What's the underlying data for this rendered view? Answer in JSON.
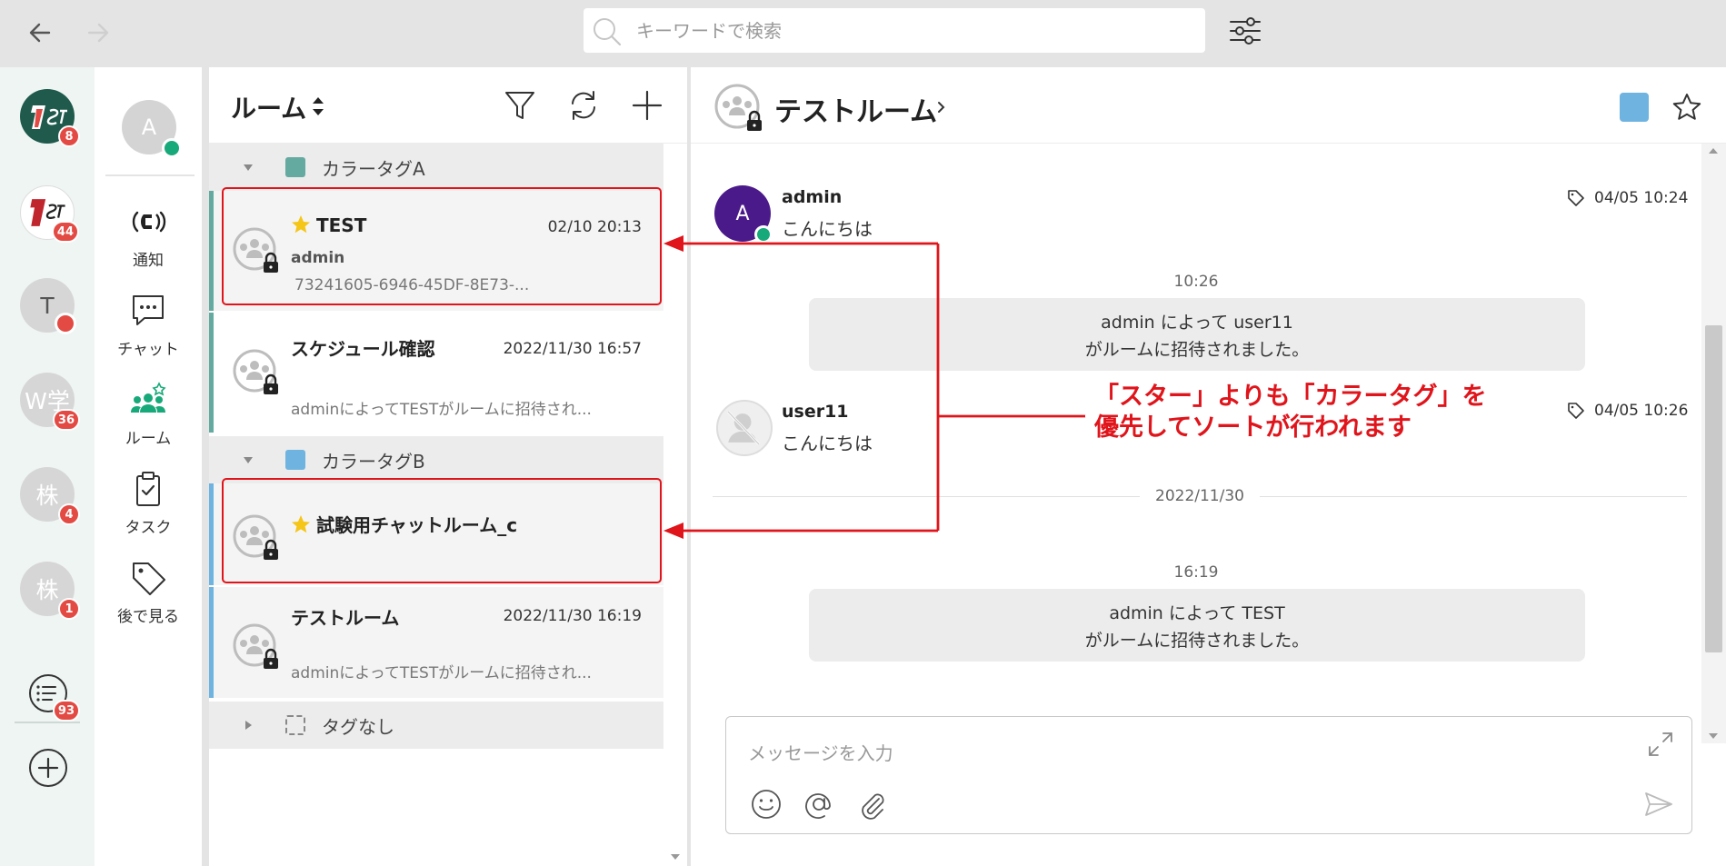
{
  "search": {
    "placeholder": "キーワードで検索"
  },
  "orgs": [
    {
      "label": "1ST",
      "badge": "8"
    },
    {
      "label": "1ST",
      "badge": "44"
    },
    {
      "label": "T",
      "badge": ""
    },
    {
      "label": "W学",
      "badge": "36"
    },
    {
      "label": "株",
      "badge": "4"
    },
    {
      "label": "株",
      "badge": "1"
    }
  ],
  "rail_list_badge": "93",
  "me": {
    "initial": "A"
  },
  "nav": {
    "notify": "通知",
    "chat": "チャット",
    "room": "ルーム",
    "task": "タスク",
    "later": "後で見る"
  },
  "roomlist": {
    "title": "ルーム",
    "groups": [
      {
        "label": "カラータグA",
        "color": "#64aaa0"
      },
      {
        "label": "カラータグB",
        "color": "#6fb3e0"
      },
      {
        "label": "タグなし",
        "color": ""
      }
    ],
    "rooms": [
      {
        "title": "TEST",
        "starred": true,
        "time": "02/10 20:13",
        "sender": "admin",
        "preview": "73241605-6946-45DF-8E73-..."
      },
      {
        "title": "スケジュール確認",
        "starred": false,
        "time": "2022/11/30 16:57",
        "sender": "",
        "preview": "adminによってTESTがルームに招待され..."
      },
      {
        "title": "試験用チャットルーム_c",
        "starred": true,
        "time": "",
        "sender": "",
        "preview": ""
      },
      {
        "title": "テストルーム",
        "starred": false,
        "time": "2022/11/30 16:19",
        "sender": "",
        "preview": "adminによってTESTがルームに招待され..."
      }
    ]
  },
  "chat": {
    "title": "テストルーム",
    "header_color": "#6fb3e0",
    "messages": [
      {
        "avatar": "A",
        "name": "admin",
        "text": "こんにちは",
        "time": "04/05 10:24"
      },
      {
        "avatar": "",
        "name": "user11",
        "text": "こんにちは",
        "time": "04/05 10:26"
      }
    ],
    "system": [
      {
        "time": "10:26",
        "line1": "admin によって user11",
        "line2": "がルームに招待されました。"
      },
      {
        "time": "16:19",
        "line1": "admin によって TEST",
        "line2": "がルームに招待されました。"
      }
    ],
    "date_separator": "2022/11/30",
    "composer_placeholder": "メッセージを入力"
  },
  "annotation": {
    "line1": "「スター」よりも「カラータグ」を",
    "line2": "優先してソートが行われます",
    "color": "#e0141b"
  }
}
